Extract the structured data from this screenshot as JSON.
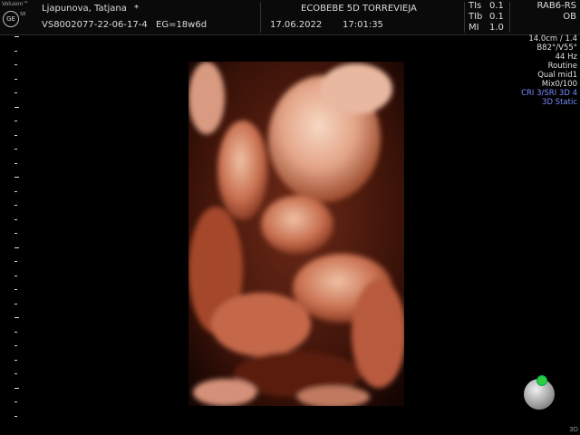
{
  "header": {
    "brand": "Voluson™",
    "brand_sub": "S8",
    "logo": "GE",
    "patient_name": "Ljapunova, Tatjana",
    "patient_star": "*",
    "study_id": "VS8002077-22-06-17-4",
    "ga": "EG=18w6d",
    "clinic": "ECOBEBE 5D TORREVIEJA",
    "date": "17.06.2022",
    "time": "17:01:35",
    "tis_label": "TIs",
    "tis_value": "0.1",
    "tib_label": "TIb",
    "tib_value": "0.1",
    "mi_label": "MI",
    "mi_value": "1.0",
    "probe": "RAB6-RS",
    "application": "OB"
  },
  "params": [
    "14.0cm / 1.4",
    "B82°/V55°",
    "44 Hz",
    "Routine",
    "Qual mid1",
    "Mix0/100"
  ],
  "params_blue": [
    "CRI 3/SRI 3D 4",
    "3D Static"
  ],
  "footer": {
    "mode": "3D"
  },
  "colors": {
    "tissue": "#c86a4a",
    "background": "#000000",
    "highlight_blue": "#7a8cff",
    "trackball_dot": "#2ecc40"
  }
}
